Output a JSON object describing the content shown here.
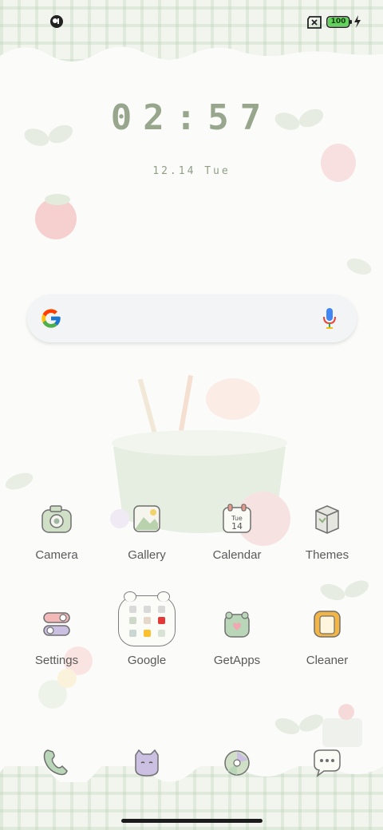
{
  "status_bar": {
    "battery_level": "100",
    "icons": [
      "notification-icon",
      "no-sim-icon",
      "battery-icon",
      "charging-icon"
    ]
  },
  "lock_clock": {
    "time": "02:57",
    "date": "12.14 Tue"
  },
  "search": {
    "icons": [
      "google-logo-icon",
      "microphone-icon"
    ]
  },
  "apps": {
    "row1": [
      {
        "label": "Camera",
        "icon": "camera-icon"
      },
      {
        "label": "Gallery",
        "icon": "gallery-icon"
      },
      {
        "label": "Calendar",
        "icon": "calendar-icon",
        "badge_day": "Tue",
        "badge_date": "14"
      },
      {
        "label": "Themes",
        "icon": "themes-icon"
      }
    ],
    "row2": [
      {
        "label": "Settings",
        "icon": "settings-icon"
      },
      {
        "label": "Google",
        "icon": "google-folder-icon"
      },
      {
        "label": "GetApps",
        "icon": "getapps-icon"
      },
      {
        "label": "Cleaner",
        "icon": "cleaner-icon"
      }
    ]
  },
  "dock": [
    "phone-icon",
    "messaging-cat-icon",
    "browser-ball-icon",
    "messages-icon"
  ],
  "colors": {
    "accent_green": "#97a68c",
    "background": "#fbfcfa",
    "battery_green": "#5fd35a"
  }
}
